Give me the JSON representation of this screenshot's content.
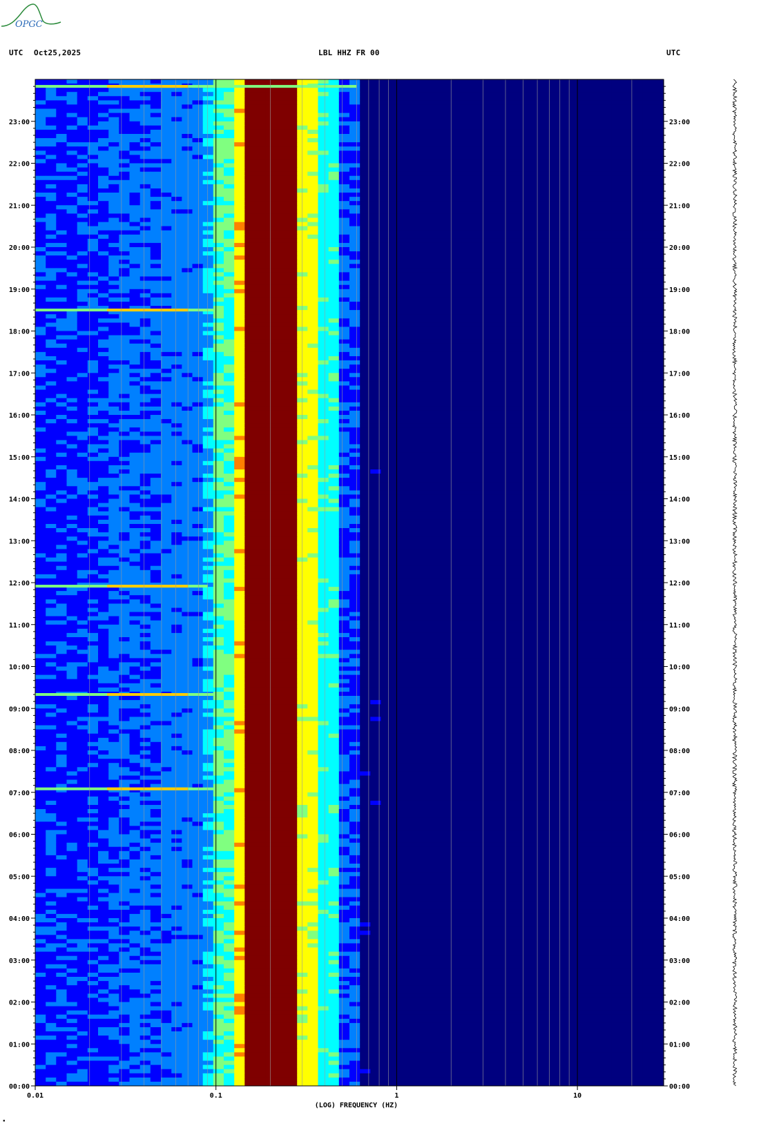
{
  "header": {
    "left_tz": "UTC",
    "date": "Oct25,2025",
    "station": "LBL HHZ FR 00",
    "right_tz": "UTC"
  },
  "logo": {
    "text": "OPGC",
    "color": "#2a8a3a"
  },
  "chart_data": {
    "type": "heatmap",
    "title": "LBL HHZ FR 00",
    "xlabel": "(LOG) FREQUENCY (HZ)",
    "x_scale": "log",
    "xlim": [
      0.01,
      30
    ],
    "x_ticks": [
      "0.01",
      "0.1",
      "1",
      "10"
    ],
    "x_tick_values": [
      0.01,
      0.1,
      1,
      10
    ],
    "ylabel_left": "UTC",
    "ylabel_right": "UTC",
    "ylim_hours": [
      0,
      24
    ],
    "y_ticks": [
      "00:00",
      "01:00",
      "02:00",
      "03:00",
      "04:00",
      "05:00",
      "06:00",
      "07:00",
      "08:00",
      "09:00",
      "10:00",
      "11:00",
      "12:00",
      "13:00",
      "14:00",
      "15:00",
      "16:00",
      "17:00",
      "18:00",
      "19:00",
      "20:00",
      "21:00",
      "22:00",
      "23:00"
    ],
    "colormap": [
      "#00007f",
      "#0000ff",
      "#0080ff",
      "#00ffff",
      "#80ff80",
      "#ffff00",
      "#ff8000",
      "#ff0000",
      "#7f0000"
    ],
    "background_color": "#0a14a8",
    "energy_band_hz": [
      0.15,
      0.3
    ],
    "events_utc": [
      {
        "time": "07:05",
        "max_freq_hz": 0.1
      },
      {
        "time": "09:20",
        "max_freq_hz": 0.1
      },
      {
        "time": "11:55",
        "max_freq_hz": 0.09
      },
      {
        "time": "18:30",
        "max_freq_hz": 0.1
      },
      {
        "time": "23:50",
        "max_freq_hz": 0.6
      }
    ]
  }
}
